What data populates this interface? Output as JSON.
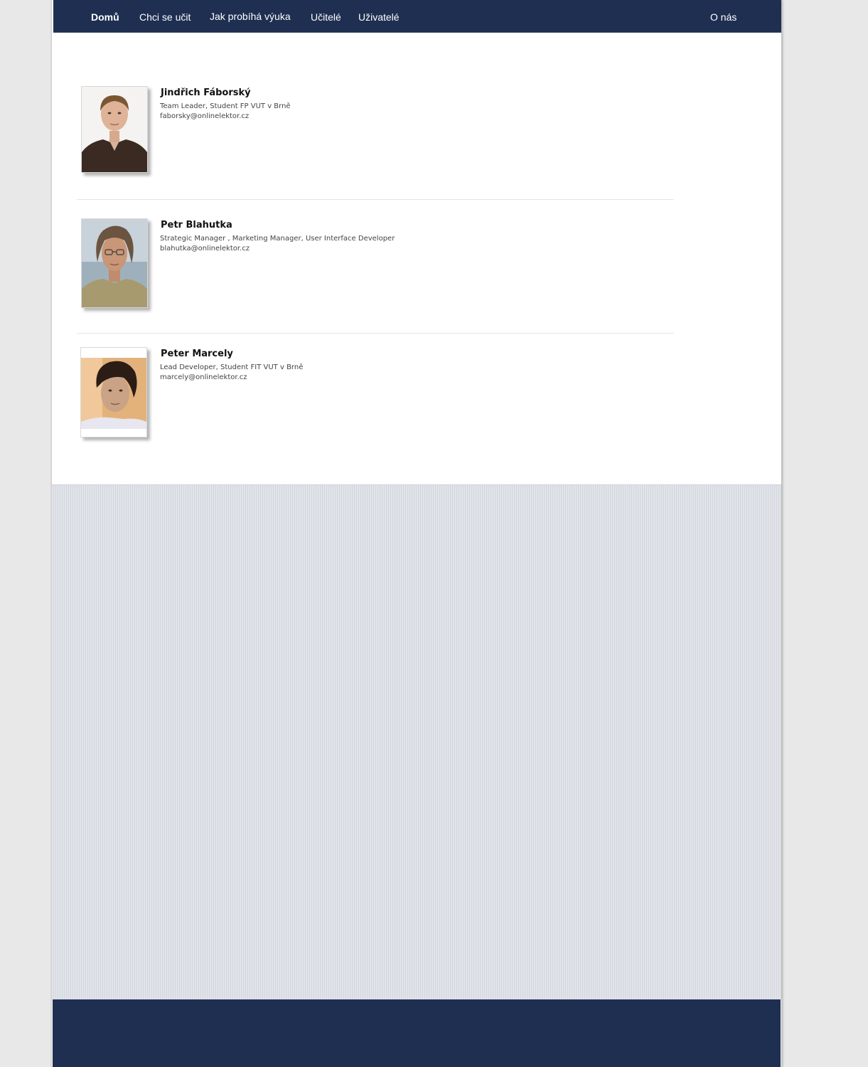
{
  "nav": {
    "home": "Domů",
    "learn": "Chci se učit",
    "how": "Jak probíhá výuka",
    "teachers": "Učitelé",
    "users": "Uživatelé",
    "about": "O nás"
  },
  "team": [
    {
      "name": "Jindřich Fáborský",
      "role": "Team Leader, Student FP VUT v Brně",
      "email": "faborsky@onlinelektor.cz"
    },
    {
      "name": "Petr Blahutka",
      "role": "Strategic Manager , Marketing Manager, User Interface Developer",
      "email": "blahutka@onlinelektor.cz"
    },
    {
      "name": "Peter Marcely",
      "role": "Lead Developer, Student FIT VUT v Brně",
      "email": "marcely@onlinelektor.cz"
    }
  ],
  "colors": {
    "nav_bg": "#1e2f51",
    "footer_bg": "#1e2f51",
    "stripe_light": "#e1e4e9",
    "stripe_dark": "#d3d7de"
  }
}
